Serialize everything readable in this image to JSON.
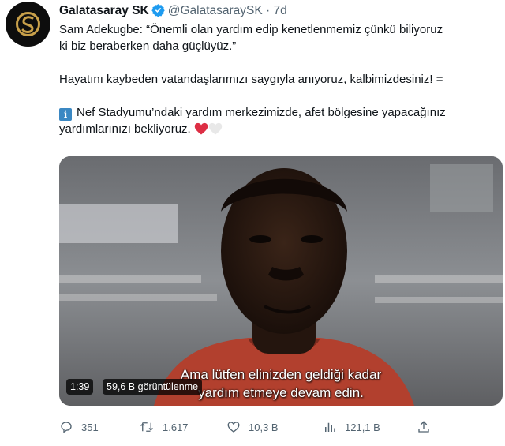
{
  "tweet": {
    "name": "Galatasaray SK",
    "verified_icon": "verified-badge-icon",
    "handle": "@GalatasaraySK",
    "separator": "·",
    "time": "7d",
    "line1": "Sam Adekugbe: “Önemli olan yardım edip kenetlenmemiz çünkü biliyoruz",
    "line2": "ki biz beraberken daha güçlüyüz.”",
    "line3": "Hayatını kaybeden vatandaşlarımızı saygıyla anıyoruz, kalbimizdesiniz! =",
    "info_icon": "i",
    "line4": "Nef Stadyumu’ndaki yardım merkezimizde, afet bölgesine yapacağınız",
    "line5": "yardımlarınızı bekliyoruz.",
    "heart_colors": [
      "#dd2e44",
      "#e8e8e8"
    ]
  },
  "video": {
    "duration": "1:39",
    "views": "59,6 B görüntülenme",
    "subtitle_line1": "Ama lütfen elinizden geldiği kadar",
    "subtitle_line2": "yardım etmeye devam edin."
  },
  "actions": {
    "replies": "351",
    "retweets": "1.617",
    "likes": "10,3 B",
    "views": "121,1 B"
  },
  "colors": {
    "accent": "#1d9bf0",
    "muted": "#536471",
    "brand_red": "#a90432",
    "brand_yellow": "#fdb912"
  }
}
